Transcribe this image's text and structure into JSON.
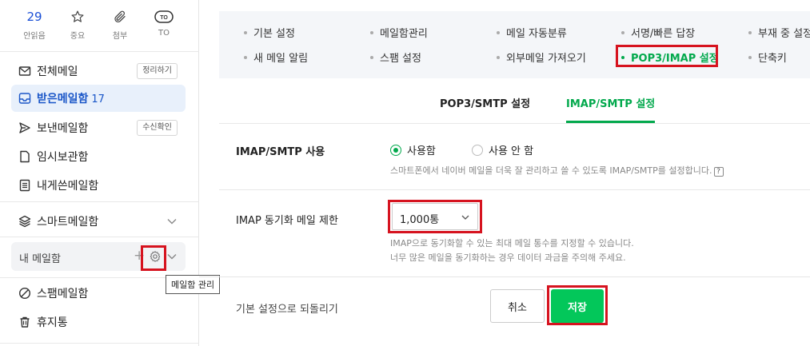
{
  "sidebar": {
    "quick": [
      {
        "top": "29",
        "label": "안읽음",
        "icon": "unread-count"
      },
      {
        "top": "",
        "label": "중요",
        "icon": "star-icon"
      },
      {
        "top": "",
        "label": "첨부",
        "icon": "paperclip-icon"
      },
      {
        "top": "TO",
        "label": "TO",
        "icon": "to-icon"
      }
    ],
    "items": [
      {
        "label": "전체메일",
        "icon": "envelope-icon",
        "pill": "정리하기"
      },
      {
        "label": "받은메일함",
        "icon": "inbox-icon",
        "count": "17",
        "active": true
      },
      {
        "label": "보낸메일함",
        "icon": "send-icon",
        "pill": "수신확인"
      },
      {
        "label": "임시보관함",
        "icon": "draft-icon"
      },
      {
        "label": "내게쓴메일함",
        "icon": "note-icon"
      },
      {
        "label": "스마트메일함",
        "icon": "layers-icon"
      },
      {
        "label": "스팸메일함",
        "icon": "spam-icon"
      },
      {
        "label": "휴지통",
        "icon": "trash-icon"
      }
    ],
    "my_mailbox": {
      "label": "내 메일함",
      "plus": "+"
    },
    "tooltip": "메일함 관리"
  },
  "settings_menu": [
    {
      "label": "기본 설정"
    },
    {
      "label": "메일함관리"
    },
    {
      "label": "메일 자동분류"
    },
    {
      "label": "서명/빠른 답장"
    },
    {
      "label": "부재 중 설정"
    },
    {
      "label": "새 메일 알림"
    },
    {
      "label": "스팸 설정"
    },
    {
      "label": "외부메일 가져오기"
    },
    {
      "label": "POP3/IMAP 설정",
      "active": true
    },
    {
      "label": "단축키"
    }
  ],
  "tabs": [
    {
      "label": "POP3/SMTP 설정"
    },
    {
      "label": "IMAP/SMTP 설정",
      "active": true
    }
  ],
  "imap": {
    "use_label": "IMAP/SMTP 사용",
    "option_on": "사용함",
    "option_off": "사용 안 함",
    "selected": "사용함",
    "use_desc": "스마트폰에서 네이버 메일을 더욱 잘 관리하고 쓸 수 있도록 IMAP/SMTP를 설정합니다.",
    "help": "?",
    "limit_label": "IMAP 동기화 메일 제한",
    "limit_value": "1,000통",
    "limit_desc1": "IMAP으로 동기화할 수 있는 최대 메일 통수를 지정할 수 있습니다.",
    "limit_desc2": "너무 많은 메일을 동기화하는 경우 데이터 과금을 주의해 주세요."
  },
  "footer": {
    "reset": "기본 설정으로 되돌리기",
    "cancel": "취소",
    "save": "저장"
  },
  "colors": {
    "accent_green": "#03c75a",
    "active_blue": "#1a56c8",
    "highlight_red": "#d6131f"
  }
}
